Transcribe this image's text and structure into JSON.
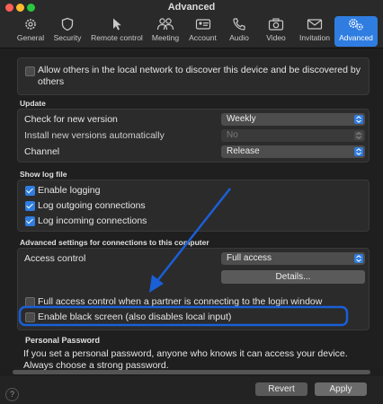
{
  "window": {
    "title": "Advanced"
  },
  "toolbar": {
    "items": [
      {
        "label": "General",
        "icon": "gear-icon"
      },
      {
        "label": "Security",
        "icon": "shield-icon"
      },
      {
        "label": "Remote control",
        "icon": "cursor-icon"
      },
      {
        "label": "Meeting",
        "icon": "people-icon"
      },
      {
        "label": "Account",
        "icon": "id-card-icon"
      },
      {
        "label": "Audio",
        "icon": "phone-icon"
      },
      {
        "label": "Video",
        "icon": "camera-icon"
      },
      {
        "label": "Invitation",
        "icon": "envelope-icon"
      },
      {
        "label": "Advanced",
        "icon": "gears-icon"
      }
    ],
    "active": "Advanced",
    "accent_color": "#2f7de1"
  },
  "discover": {
    "label": "Allow others in the local network to discover this device and be discovered by others",
    "checked": false
  },
  "update": {
    "title": "Update",
    "check_label": "Check for new version",
    "check_value": "Weekly",
    "install_label": "Install new versions automatically",
    "install_value": "No",
    "channel_label": "Channel",
    "channel_value": "Release"
  },
  "logfile": {
    "title": "Show log file",
    "items": [
      {
        "label": "Enable logging",
        "checked": true
      },
      {
        "label": "Log outgoing connections",
        "checked": true
      },
      {
        "label": "Log incoming connections",
        "checked": true
      }
    ]
  },
  "connections": {
    "title": "Advanced settings for connections to this computer",
    "access_label": "Access control",
    "access_value": "Full access",
    "details_button": "Details...",
    "full_access_label": "Full access control when a partner is connecting to the login window",
    "black_screen_label": "Enable black screen (also disables local input)"
  },
  "password": {
    "title": "Personal Password",
    "text": "If you set a personal password, anyone who knows it can access your device. Always choose a strong password."
  },
  "footer": {
    "help": "?",
    "revert": "Revert",
    "apply": "Apply"
  },
  "annotation": {
    "color": "#1a5fd6"
  }
}
